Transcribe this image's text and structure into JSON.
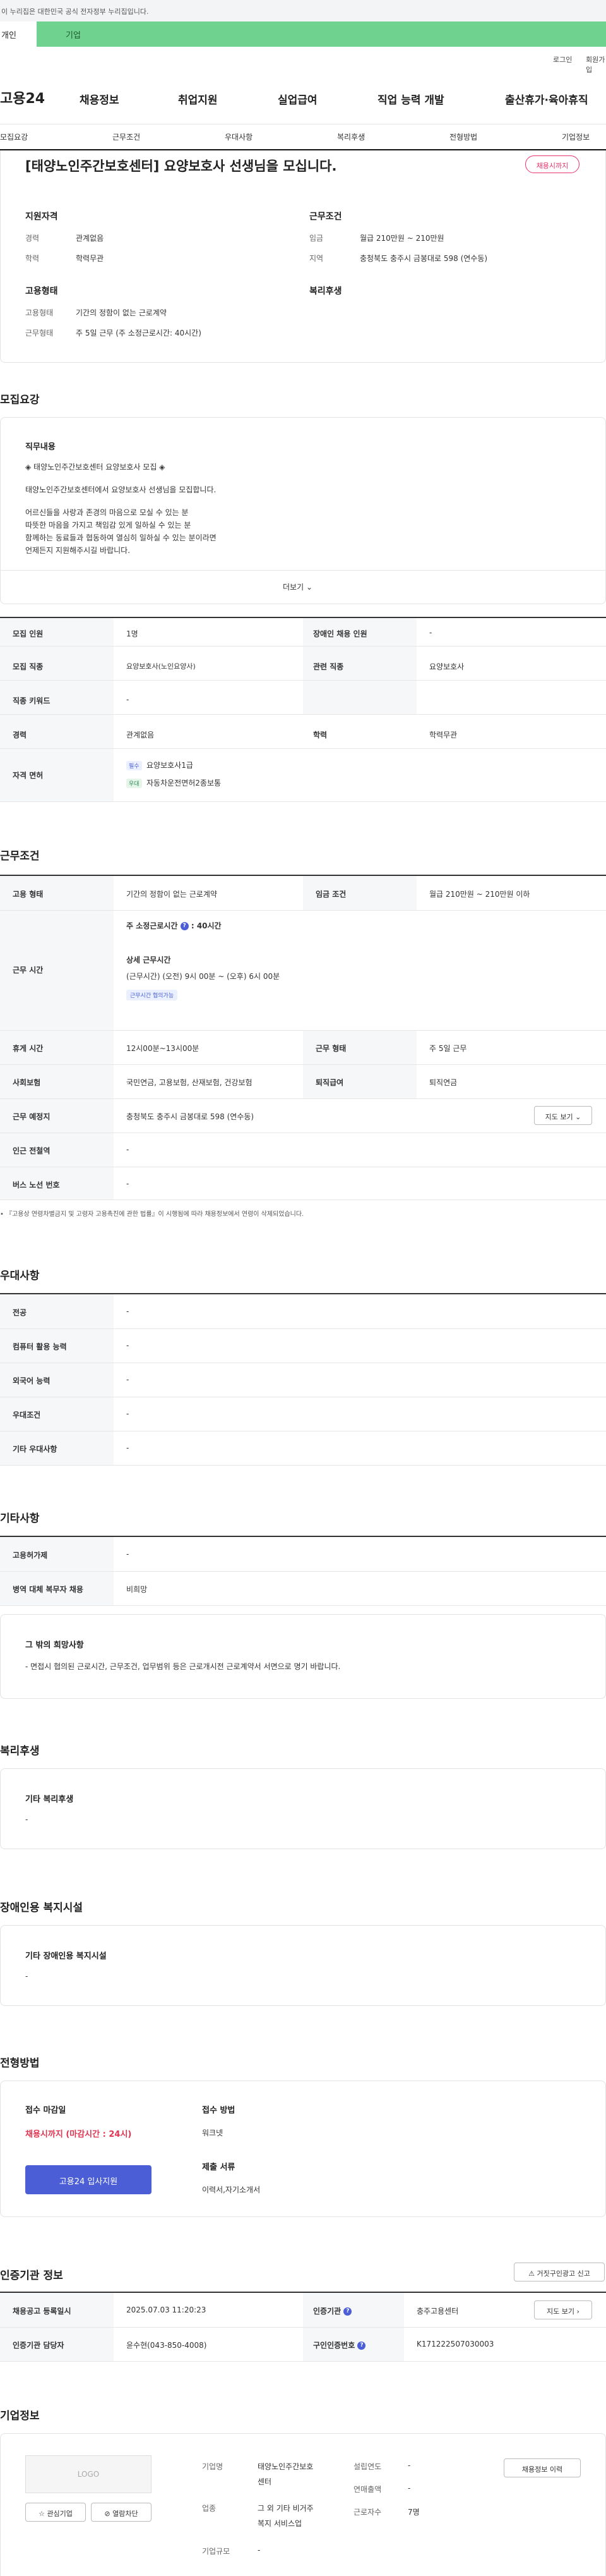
{
  "gov_bar": {
    "text": "이 누리집은 대한민국 공식 전자정부 누리집입니다."
  },
  "audience_tabs": {
    "individual": "개인",
    "corporate": "기업"
  },
  "util": {
    "login": "로그인",
    "signup": "회원가입"
  },
  "brand": {
    "logo": "고용24"
  },
  "gnb": [
    "채용정보",
    "취업지원",
    "실업급여",
    "직업 능력 개발",
    "출산휴가·육아휴직"
  ],
  "subnav": [
    "모집요강",
    "근무조건",
    "우대사항",
    "복리후생",
    "전형방법",
    "기업정보"
  ],
  "posting": {
    "title": "[태양노인주간보호센터] 요양보호사 선생님을 모십니다.",
    "status_badge": "채용시까지",
    "qual": {
      "heading": "지원자격",
      "career_label": "경력",
      "career_value": "관계없음",
      "edu_label": "학력",
      "edu_value": "학력무관"
    },
    "cond": {
      "heading": "근무조건",
      "wage_label": "임금",
      "wage_value": "월급 210만원 ~ 210만원",
      "region_label": "지역",
      "region_value": "충청북도 충주시 금봉대로 598 (연수동)"
    },
    "emp": {
      "heading": "고용형태",
      "type_label": "고용형태",
      "type_value": "기간의 정함이 없는 근로계약",
      "shift_label": "근무형태",
      "shift_value": "주 5일 근무 (주 소정근로시간: 40시간)"
    },
    "welfare": {
      "heading": "복리후생"
    }
  },
  "recruit": {
    "heading": "모집요강",
    "duty_title": "직무내용",
    "duty_lines": [
      "◈ 태양노인주간보호센터 요양보호사 모집 ◈",
      "태양노인주간보호센터에서 요양보호사 선생님을 모집합니다.",
      "어르신들을 사랑과 존경의 마음으로 모실 수 있는 분",
      "따뜻한 마음을 가지고 책임감 있게 일하실 수 있는 분",
      "함께하는 동료들과 협동하여 열심히 일하실 수 있는 분이라면",
      "언제든지 지원해주시길 바랍니다."
    ],
    "more": "더보기",
    "table": {
      "headcount_label": "모집 인원",
      "headcount_value": "1명",
      "disabled_label": "장애인 채용 인원",
      "disabled_value": "-",
      "job_label": "모집 직종",
      "job_value": "요양보호사(노인요양사)",
      "related_label": "관련 직종",
      "related_value": "요양보호사",
      "keyword_label": "직종 키워드",
      "keyword_value": "-",
      "career_label": "경력",
      "career_value": "관계없음",
      "edu_label": "학력",
      "edu_value": "학력무관",
      "license_label": "자격 면허",
      "license_required_tag": "필수",
      "license_required": "요양보호사1급",
      "license_preferred_tag": "우대",
      "license_preferred": "자동차운전면허2종보통"
    }
  },
  "work": {
    "heading": "근무조건",
    "emp_label": "고용 형태",
    "emp_value": "기간의 정함이 없는 근로계약",
    "wage_label": "임금 조건",
    "wage_value": "월급 210만원 ~ 210만원 이하",
    "hours_label": "근무 시간",
    "hours_weekly": "주 소정근로시간",
    "hours_weekly_value": ": 40시간",
    "hours_detail_title": "상세 근무시간",
    "hours_detail": "(근무시간) (오전) 9시 00분 ~ (오후) 6시 00분",
    "hours_tag": "근무시간 협의가능",
    "break_label": "휴게 시간",
    "break_value": "12시00분~13시00분",
    "shift_label": "근무 형태",
    "shift_value": "주 5일 근무",
    "insurance_label": "사회보험",
    "insurance_value": "국민연금, 고용보험, 산재보험, 건강보험",
    "severance_label": "퇴직급여",
    "severance_value": "퇴직연금",
    "place_label": "근무 예정지",
    "place_value": "충청북도 충주시 금봉대로 598 (연수동)",
    "map_btn": "지도 보기",
    "subway_label": "인근 전철역",
    "subway_value": "-",
    "bus_label": "버스 노선 번호",
    "bus_value": "-",
    "note": "『고용상 연령차별금지 및 고령자 고용촉진에 관한 법률』이 시행됨에 따라 채용정보에서 연령이 삭제되었습니다."
  },
  "pref": {
    "heading": "우대사항",
    "rows": [
      {
        "label": "전공",
        "value": "-"
      },
      {
        "label": "컴퓨터 활용 능력",
        "value": "-"
      },
      {
        "label": "외국어 능력",
        "value": "-"
      },
      {
        "label": "우대조건",
        "value": "-"
      },
      {
        "label": "기타 우대사항",
        "value": "-"
      }
    ]
  },
  "etc": {
    "heading": "기타사항",
    "rows": [
      {
        "label": "고용허가제",
        "value": "-"
      },
      {
        "label": "병역 대체 복무자 채용",
        "value": "비희망"
      }
    ],
    "wish_title": "그 밖의 희망사항",
    "wish_text": "- 면접시 협의된 근로시간, 근무조건, 업무범위 등은 근로개시전 근로계약서 서면으로 명기 바랍니다."
  },
  "benefits": {
    "heading": "복리후생",
    "box_title": "기타 복리후생",
    "box_value": "-"
  },
  "facilities": {
    "heading": "장애인용 복지시설",
    "box_title": "기타 장애인용 복지시설",
    "box_value": "-"
  },
  "selection": {
    "heading": "전형방법",
    "deadline_title": "접수 마감일",
    "deadline_value": "채용시까지 (마감시간 : 24시)",
    "method_title": "접수 방법",
    "method_value": "워크넷",
    "docs_title": "제출 서류",
    "docs_value": "이력서,자기소개서",
    "apply_btn": "고용24 입사지원"
  },
  "cert": {
    "heading": "인증기관 정보",
    "report_btn": "거짓구인광고 신고",
    "reg_label": "채용공고 등록일시",
    "reg_value": "2025.07.03 11:20:23",
    "org_label": "인증기관",
    "org_value": "충주고용센터",
    "map_btn": "지도 보기",
    "manager_label": "인증기관 담당자",
    "manager_value": "윤수현(043-850-4008)",
    "number_label": "구인인증번호",
    "number_value": "K171222507030003"
  },
  "company": {
    "heading": "기업정보",
    "logo": "LOGO",
    "fav_btn": "관심기업",
    "block_btn": "열람차단",
    "history_btn": "채용정보 이력",
    "name_label": "기업명",
    "name_value_1": "태양노인주간보호",
    "name_value_2": "센터",
    "industry_label": "업종",
    "industry_value_1": "그 외 기타 비거주",
    "industry_value_2": "복지 서비스업",
    "size_label": "기업규모",
    "size_value": "-",
    "founded_label": "설립연도",
    "founded_value": "-",
    "sales_label": "연매출액",
    "sales_value": "-",
    "workers_label": "근로자수",
    "workers_value": "7명"
  }
}
